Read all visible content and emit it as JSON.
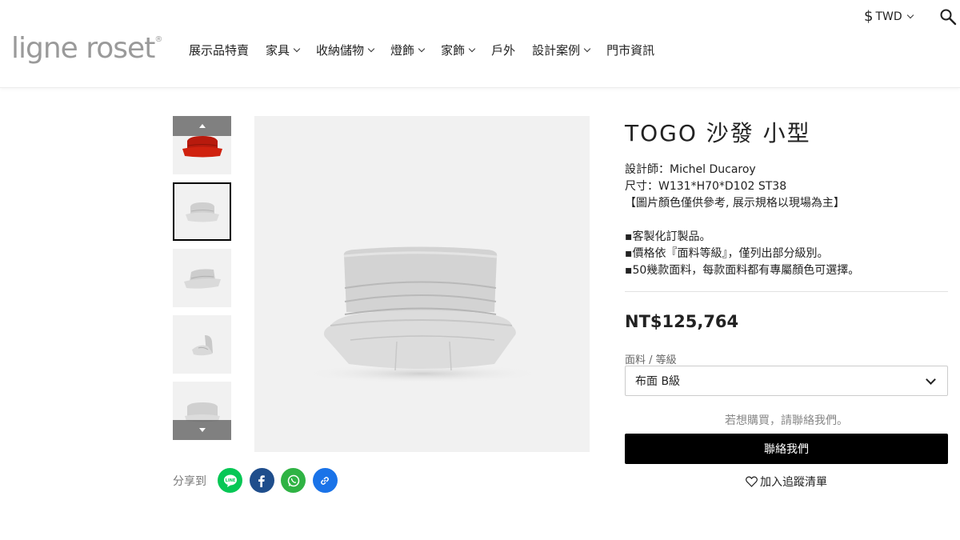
{
  "header": {
    "logo_text": "ligne roset",
    "logo_mark": "®",
    "nav": [
      {
        "label": "展示品特賣",
        "has_dropdown": false
      },
      {
        "label": "家具",
        "has_dropdown": true
      },
      {
        "label": "收納儲物",
        "has_dropdown": true
      },
      {
        "label": "燈飾",
        "has_dropdown": true
      },
      {
        "label": "家飾",
        "has_dropdown": true
      },
      {
        "label": "戶外",
        "has_dropdown": false
      },
      {
        "label": "設計案例",
        "has_dropdown": true
      },
      {
        "label": "門市資訊",
        "has_dropdown": false
      }
    ],
    "currency": {
      "symbol": "$",
      "code": "TWD"
    },
    "search_icon": "search-icon"
  },
  "gallery": {
    "thumbnails": [
      {
        "alt": "red sofa",
        "color": "#c81d10"
      },
      {
        "alt": "grey sofa front",
        "color": "#d7d7d7",
        "active": true
      },
      {
        "alt": "grey sofa angle",
        "color": "#d7d7d7"
      },
      {
        "alt": "grey sofa side",
        "color": "#d7d7d7"
      },
      {
        "alt": "grey sofa back",
        "color": "#d7d7d7"
      }
    ]
  },
  "share": {
    "label": "分享到",
    "buttons": [
      {
        "name": "line",
        "color": "#06c755"
      },
      {
        "name": "facebook",
        "color": "#1f4e8c"
      },
      {
        "name": "whatsapp",
        "color": "#2fb344"
      },
      {
        "name": "copy-link",
        "color": "#1a73e8"
      }
    ]
  },
  "product": {
    "title": "TOGO 沙發 小型",
    "description": [
      "設計師：Michel Ducaroy",
      "尺寸：W131*H70*D102  ST38",
      "【圖片顏色僅供參考, 展示規格以現場為主】",
      "",
      "▪客製化訂製品。",
      "▪價格依『面料等級』，僅列出部分級別。",
      "▪50幾款面料，每款面料都有專屬顏色可選擇。"
    ],
    "price": "NT$125,764",
    "fabric_label": "面料 / 等級",
    "fabric_selected": "布面 B級",
    "contact_hint": "若想購買，請聯絡我們。",
    "contact_button": "聯絡我們",
    "wishlist_label": "加入追蹤清單"
  }
}
